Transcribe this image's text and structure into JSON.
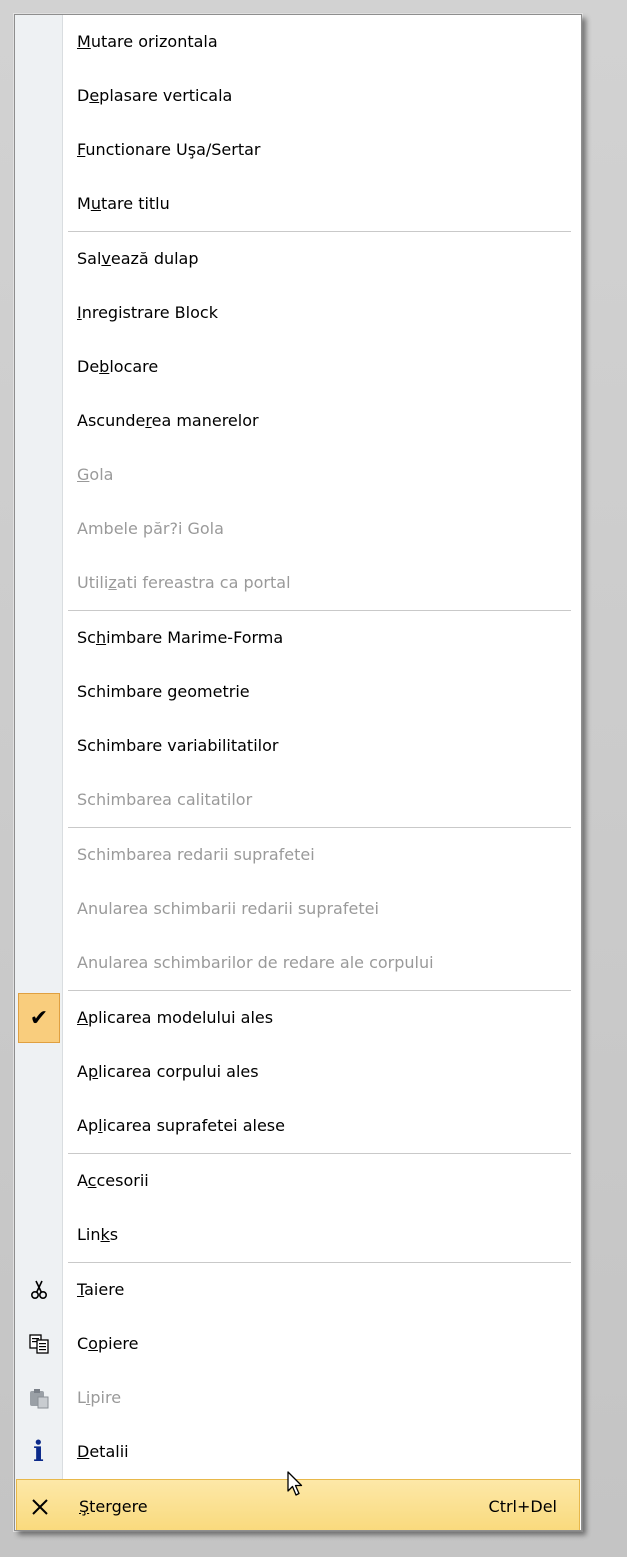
{
  "menu": {
    "groups": [
      [
        {
          "pre": "",
          "ul": "M",
          "post": "utare orizontala",
          "disabled": false
        },
        {
          "pre": "D",
          "ul": "e",
          "post": "plasare verticala",
          "disabled": false
        },
        {
          "pre": "",
          "ul": "F",
          "post": "unctionare Uşa/Sertar",
          "disabled": false
        },
        {
          "pre": "M",
          "ul": "u",
          "post": "tare titlu",
          "disabled": false
        }
      ],
      [
        {
          "pre": "Sal",
          "ul": "v",
          "post": "ează dulap",
          "disabled": false
        },
        {
          "pre": "",
          "ul": "I",
          "post": "nregistrare Block",
          "disabled": false
        },
        {
          "pre": "De",
          "ul": "b",
          "post": "locare",
          "disabled": false
        },
        {
          "pre": "Ascunde",
          "ul": "r",
          "post": "ea manerelor",
          "disabled": false
        },
        {
          "pre": "",
          "ul": "G",
          "post": "ola",
          "disabled": true
        },
        {
          "pre": "Ambele păr?i Gola",
          "ul": "",
          "post": "",
          "disabled": true
        },
        {
          "pre": "Utili",
          "ul": "z",
          "post": "ati fereastra ca portal",
          "disabled": true
        }
      ],
      [
        {
          "pre": "Sc",
          "ul": "h",
          "post": "imbare Marime-Forma",
          "disabled": false
        },
        {
          "pre": "Schimbare geometrie",
          "ul": "",
          "post": "",
          "disabled": false
        },
        {
          "pre": "Schimbare variabilitatilor",
          "ul": "",
          "post": "",
          "disabled": false
        },
        {
          "pre": "Schimbarea calitatilor",
          "ul": "",
          "post": "",
          "disabled": true
        }
      ],
      [
        {
          "pre": "Schimbarea redarii suprafetei",
          "ul": "",
          "post": "",
          "disabled": true
        },
        {
          "pre": "Anularea schimbarii redarii suprafetei",
          "ul": "",
          "post": "",
          "disabled": true
        },
        {
          "pre": "Anularea schimbarilor de redare ale corpului",
          "ul": "",
          "post": "",
          "disabled": true
        }
      ],
      [
        {
          "pre": "",
          "ul": "A",
          "post": "plicarea modelului ales",
          "disabled": false,
          "checked": true
        },
        {
          "pre": "A",
          "ul": "p",
          "post": "licarea corpului ales",
          "disabled": false
        },
        {
          "pre": "Ap",
          "ul": "l",
          "post": "icarea suprafetei alese",
          "disabled": false
        }
      ],
      [
        {
          "pre": "A",
          "ul": "c",
          "post": "cesorii",
          "disabled": false
        },
        {
          "pre": "Lin",
          "ul": "k",
          "post": "s",
          "disabled": false
        }
      ],
      [
        {
          "pre": "",
          "ul": "T",
          "post": "aiere",
          "disabled": false,
          "icon": "scissors-icon"
        },
        {
          "pre": "C",
          "ul": "o",
          "post": "piere",
          "disabled": false,
          "icon": "copy-icon"
        },
        {
          "pre": "L",
          "ul": "i",
          "post": "pire",
          "disabled": true,
          "icon": "paste-icon"
        },
        {
          "pre": "",
          "ul": "D",
          "post": "etalii",
          "disabled": false,
          "icon": "info-icon"
        },
        {
          "pre": "",
          "ul": "Ş",
          "post": "tergere",
          "disabled": false,
          "icon": "delete-x-icon",
          "shortcut": "Ctrl+Del",
          "hover": true
        }
      ]
    ]
  },
  "icons": {
    "check": "✔",
    "scissors": "✂",
    "info": "i",
    "delete": "✕"
  },
  "colors": {
    "hover_bg": "#f9d97a",
    "check_bg": "#f9cd7d",
    "disabled_text": "#9a9a9a",
    "gutter": "#eef1f3"
  }
}
